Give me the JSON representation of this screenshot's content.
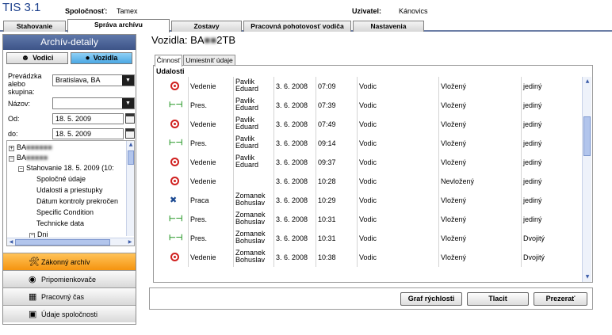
{
  "app": {
    "title": "TIS 3.1",
    "company_label": "Spoločnosť:",
    "company_value": "Tamex",
    "user_label": "Uzivatel:",
    "user_value": "Kánovics"
  },
  "top_tabs": [
    {
      "label": "Stahovanie",
      "active": false
    },
    {
      "label": "Správa archívu",
      "active": true
    },
    {
      "label": "Zostavy",
      "active": false
    },
    {
      "label": "Pracovná pohotovosť vodiča",
      "active": false
    },
    {
      "label": "Nastavenia",
      "active": false
    }
  ],
  "left_panel": {
    "title": "Archív-detaily",
    "mode_buttons": [
      {
        "label": "Vodici",
        "icon": "driver-icon",
        "active": false
      },
      {
        "label": "Vozidla",
        "icon": "vehicle-icon",
        "active": true
      }
    ],
    "filters": {
      "site_label": "Prevádzka alebo skupina:",
      "site_value": "Bratislava, BA",
      "name_label": "Názov:",
      "name_value": "",
      "from_label": "Od:",
      "from_value": "18. 5. 2009",
      "to_label": "do:",
      "to_value": "18. 5. 2009"
    },
    "tree": [
      {
        "label": "BA",
        "level": 0,
        "toggle": "+",
        "blurred": true
      },
      {
        "label": "BA",
        "level": 0,
        "toggle": "−",
        "blurred": true
      },
      {
        "label": "Stahovanie 18. 5. 2009 (10:",
        "level": 1,
        "toggle": "−"
      },
      {
        "label": "Spoločné údaje",
        "level": 2
      },
      {
        "label": "Udalosti a priestupky",
        "level": 2
      },
      {
        "label": "Dátum kontroly prekročen",
        "level": 2
      },
      {
        "label": "Specific Condition",
        "level": 2
      },
      {
        "label": "Technicke data",
        "level": 2
      },
      {
        "label": "Dni",
        "level": 2,
        "toggle": "−"
      }
    ],
    "nav_buttons": [
      {
        "label": "Zákonný archív",
        "icon": "archive-icon",
        "active": true
      },
      {
        "label": "Pripomienkovače",
        "icon": "reminder-icon",
        "active": false
      },
      {
        "label": "Pracovný čas",
        "icon": "worktime-icon",
        "active": false
      },
      {
        "label": "Údaje spoločnosti",
        "icon": "company-data-icon",
        "active": false
      }
    ]
  },
  "main": {
    "title_prefix": "Vozidla: BA",
    "title_suffix": "2TB",
    "sub_tabs": [
      {
        "label": "Činnosť",
        "active": true
      },
      {
        "label": "Umiestniť údaje",
        "active": false
      }
    ],
    "events_title": "Udalosti",
    "events": [
      {
        "icon": "target-icon",
        "type": "Vedenie",
        "driver": "Pavlik\nEduard",
        "date": "3. 6. 2008",
        "time": "07:09",
        "role": "Vodic",
        "status": "Vložený",
        "mode": "jediný"
      },
      {
        "icon": "bed-icon",
        "type": "Pres.",
        "driver": "Pavlik\nEduard",
        "date": "3. 6. 2008",
        "time": "07:39",
        "role": "Vodic",
        "status": "Vložený",
        "mode": "jediný"
      },
      {
        "icon": "target-icon",
        "type": "Vedenie",
        "driver": "Pavlik\nEduard",
        "date": "3. 6. 2008",
        "time": "07:49",
        "role": "Vodic",
        "status": "Vložený",
        "mode": "jediný"
      },
      {
        "icon": "bed-icon",
        "type": "Pres.",
        "driver": "Pavlik\nEduard",
        "date": "3. 6. 2008",
        "time": "09:14",
        "role": "Vodic",
        "status": "Vložený",
        "mode": "jediný"
      },
      {
        "icon": "target-icon",
        "type": "Vedenie",
        "driver": "Pavlik\nEduard",
        "date": "3. 6. 2008",
        "time": "09:37",
        "role": "Vodic",
        "status": "Vložený",
        "mode": "jediný"
      },
      {
        "icon": "target-icon",
        "type": "Vedenie",
        "driver": "",
        "date": "3. 6. 2008",
        "time": "10:28",
        "role": "Vodic",
        "status": "Nevložený",
        "mode": "jediný"
      },
      {
        "icon": "tools-icon",
        "type": "Praca",
        "driver": "Zomanek\nBohuslav",
        "date": "3. 6. 2008",
        "time": "10:29",
        "role": "Vodic",
        "status": "Vložený",
        "mode": "jediný"
      },
      {
        "icon": "bed-icon",
        "type": "Pres.",
        "driver": "Zomanek\nBohuslav",
        "date": "3. 6. 2008",
        "time": "10:31",
        "role": "Vodic",
        "status": "Vložený",
        "mode": "jediný"
      },
      {
        "icon": "bed-icon",
        "type": "Pres.",
        "driver": "Zomanek\nBohuslav",
        "date": "3. 6. 2008",
        "time": "10:31",
        "role": "Vodic",
        "status": "Vložený",
        "mode": "Dvojitý"
      },
      {
        "icon": "target-icon",
        "type": "Vedenie",
        "driver": "Zomanek\nBohuslav",
        "date": "3. 6. 2008",
        "time": "10:38",
        "role": "Vodic",
        "status": "Vložený",
        "mode": "Dvojitý"
      }
    ],
    "buttons": {
      "speed_chart": "Graf rýchlosti",
      "print": "Tlacit",
      "view": "Prezerať"
    }
  }
}
